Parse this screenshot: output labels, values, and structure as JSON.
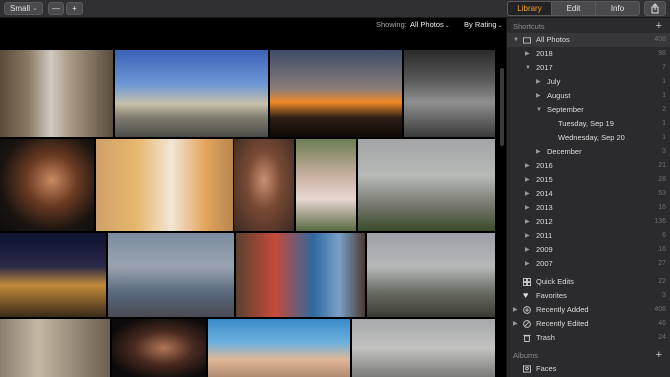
{
  "toolbar": {
    "size_label": "Small",
    "zoom_out": "—",
    "zoom_in": "+",
    "tabs": [
      "Library",
      "Edit",
      "Info"
    ],
    "active_tab": "Library"
  },
  "filter_bar": {
    "showing_label": "Showing:",
    "showing_value": "All Photos",
    "sort_value": "By Rating"
  },
  "sidebar": {
    "shortcuts_header": "Shortcuts",
    "albums_header": "Albums",
    "rows": [
      {
        "label": "All Photos",
        "count": "408",
        "expanded": true,
        "selected": true
      },
      {
        "label": "2018",
        "count": "98"
      },
      {
        "label": "2017",
        "count": "7",
        "expanded": true
      },
      {
        "label": "July",
        "count": "1"
      },
      {
        "label": "August",
        "count": "1"
      },
      {
        "label": "September",
        "count": "2",
        "expanded": true
      },
      {
        "label": "Tuesday, Sep 19",
        "count": "1"
      },
      {
        "label": "Wednesday, Sep 20",
        "count": "1"
      },
      {
        "label": "December",
        "count": "3"
      },
      {
        "label": "2016",
        "count": "21"
      },
      {
        "label": "2015",
        "count": "28"
      },
      {
        "label": "2014",
        "count": "53"
      },
      {
        "label": "2013",
        "count": "16"
      },
      {
        "label": "2012",
        "count": "136"
      },
      {
        "label": "2011",
        "count": "6"
      },
      {
        "label": "2009",
        "count": "16"
      },
      {
        "label": "2007",
        "count": "27"
      },
      {
        "label": "Quick Edits",
        "count": "22"
      },
      {
        "label": "Favorites",
        "count": "3"
      },
      {
        "label": "Recently Added",
        "count": "408"
      },
      {
        "label": "Recently Edited",
        "count": "46"
      },
      {
        "label": "Trash",
        "count": "24"
      },
      {
        "label": "Faces",
        "count": ""
      }
    ]
  },
  "colors": {
    "accent": "#f0a030",
    "sidebar_bg": "#2b2b2d",
    "toolbar_bg": "#303032"
  },
  "icons": [
    "chevron-down-icon",
    "share-icon",
    "quick-edits-icon",
    "heart-icon",
    "recently-added-icon",
    "recently-edited-icon",
    "trash-icon",
    "faces-icon",
    "folder-icon"
  ]
}
